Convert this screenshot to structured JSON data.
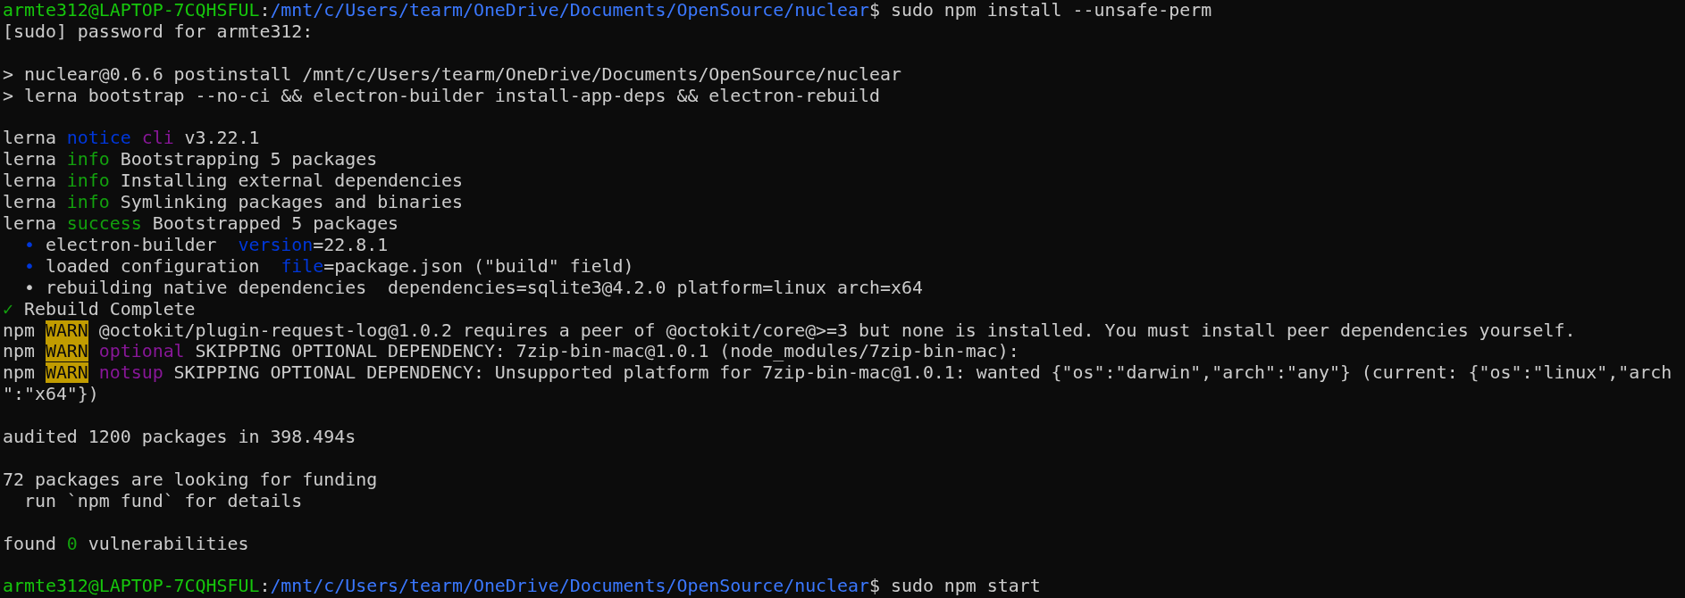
{
  "terminal": {
    "lines": [
      {
        "kind": "text",
        "segments": [
          {
            "kind": "user",
            "text": "armte312@LAPTOP-7CQHSFUL"
          },
          {
            "kind": "text",
            "text": ":"
          },
          {
            "kind": "path",
            "text": "/mnt/c/Users/tearm/OneDrive/Documents/OpenSource/nuclear"
          },
          {
            "kind": "text",
            "text": "$ sudo npm install --unsafe-perm"
          }
        ]
      },
      {
        "kind": "text",
        "segments": [
          {
            "kind": "text",
            "text": "[sudo] password for armte312:"
          }
        ]
      },
      {
        "kind": "blank"
      },
      {
        "kind": "text",
        "segments": [
          {
            "kind": "text",
            "text": "> nuclear@0.6.6 postinstall /mnt/c/Users/tearm/OneDrive/Documents/OpenSource/nuclear"
          }
        ]
      },
      {
        "kind": "text",
        "segments": [
          {
            "kind": "text",
            "text": "> lerna bootstrap --no-ci && electron-builder install-app-deps && electron-rebuild"
          }
        ]
      },
      {
        "kind": "blank"
      },
      {
        "kind": "text",
        "segments": [
          {
            "kind": "text",
            "text": "lerna "
          },
          {
            "kind": "blue",
            "text": "notice"
          },
          {
            "kind": "magenta",
            "text": " cli"
          },
          {
            "kind": "text",
            "text": " v3.22.1"
          }
        ]
      },
      {
        "kind": "text",
        "segments": [
          {
            "kind": "text",
            "text": "lerna "
          },
          {
            "kind": "green",
            "text": "info"
          },
          {
            "kind": "text",
            "text": " Bootstrapping 5 packages"
          }
        ]
      },
      {
        "kind": "text",
        "segments": [
          {
            "kind": "text",
            "text": "lerna "
          },
          {
            "kind": "green",
            "text": "info"
          },
          {
            "kind": "text",
            "text": " Installing external dependencies"
          }
        ]
      },
      {
        "kind": "text",
        "segments": [
          {
            "kind": "text",
            "text": "lerna "
          },
          {
            "kind": "green",
            "text": "info"
          },
          {
            "kind": "text",
            "text": " Symlinking packages and binaries"
          }
        ]
      },
      {
        "kind": "text",
        "segments": [
          {
            "kind": "text",
            "text": "lerna "
          },
          {
            "kind": "green",
            "text": "success"
          },
          {
            "kind": "text",
            "text": " Bootstrapped 5 packages"
          }
        ]
      },
      {
        "kind": "text",
        "segments": [
          {
            "kind": "blue",
            "text": "  •"
          },
          {
            "kind": "text",
            "text": " electron-builder  "
          },
          {
            "kind": "blue",
            "text": "version"
          },
          {
            "kind": "text",
            "text": "=22.8.1"
          }
        ]
      },
      {
        "kind": "text",
        "segments": [
          {
            "kind": "blue",
            "text": "  •"
          },
          {
            "kind": "text",
            "text": " loaded configuration  "
          },
          {
            "kind": "blue",
            "text": "file"
          },
          {
            "kind": "text",
            "text": "=package.json (\"build\" field)"
          }
        ]
      },
      {
        "kind": "text",
        "segments": [
          {
            "kind": "text",
            "text": "  • rebuilding native dependencies  dependencies=sqlite3@4.2.0 platform=linux arch=x64"
          }
        ]
      },
      {
        "kind": "text",
        "segments": [
          {
            "kind": "green",
            "text": "✓"
          },
          {
            "kind": "text",
            "text": " Rebuild Complete"
          }
        ]
      },
      {
        "kind": "text",
        "segments": [
          {
            "kind": "text",
            "text": "npm "
          },
          {
            "kind": "warn",
            "text": "WARN"
          },
          {
            "kind": "text",
            "text": " @octokit/plugin-request-log@1.0.2 requires a peer of @octokit/core@>=3 but none is installed. You must install peer dependencies yourself."
          }
        ]
      },
      {
        "kind": "text",
        "segments": [
          {
            "kind": "text",
            "text": "npm "
          },
          {
            "kind": "warn",
            "text": "WARN"
          },
          {
            "kind": "magenta",
            "text": " optional"
          },
          {
            "kind": "text",
            "text": " SKIPPING OPTIONAL DEPENDENCY: 7zip-bin-mac@1.0.1 (node_modules/7zip-bin-mac):"
          }
        ]
      },
      {
        "kind": "text",
        "segments": [
          {
            "kind": "text",
            "text": "npm "
          },
          {
            "kind": "warn",
            "text": "WARN"
          },
          {
            "kind": "magenta",
            "text": " notsup"
          },
          {
            "kind": "text",
            "text": " SKIPPING OPTIONAL DEPENDENCY: Unsupported platform for 7zip-bin-mac@1.0.1: wanted {\"os\":\"darwin\",\"arch\":\"any\"} (current: {\"os\":\"linux\",\"arch"
          }
        ]
      },
      {
        "kind": "text",
        "segments": [
          {
            "kind": "text",
            "text": "\":\"x64\"})"
          }
        ]
      },
      {
        "kind": "blank"
      },
      {
        "kind": "text",
        "segments": [
          {
            "kind": "text",
            "text": "audited 1200 packages in 398.494s"
          }
        ]
      },
      {
        "kind": "blank"
      },
      {
        "kind": "text",
        "segments": [
          {
            "kind": "text",
            "text": "72 packages are looking for funding"
          }
        ]
      },
      {
        "kind": "text",
        "segments": [
          {
            "kind": "text",
            "text": "  run `npm fund` for details"
          }
        ]
      },
      {
        "kind": "blank"
      },
      {
        "kind": "text",
        "segments": [
          {
            "kind": "text",
            "text": "found "
          },
          {
            "kind": "green",
            "text": "0"
          },
          {
            "kind": "text",
            "text": " vulnerabilities"
          }
        ]
      },
      {
        "kind": "blank"
      },
      {
        "kind": "text",
        "segments": [
          {
            "kind": "user",
            "text": "armte312@LAPTOP-7CQHSFUL"
          },
          {
            "kind": "text",
            "text": ":"
          },
          {
            "kind": "path",
            "text": "/mnt/c/Users/tearm/OneDrive/Documents/OpenSource/nuclear"
          },
          {
            "kind": "text",
            "text": "$ sudo npm start"
          }
        ]
      }
    ]
  }
}
